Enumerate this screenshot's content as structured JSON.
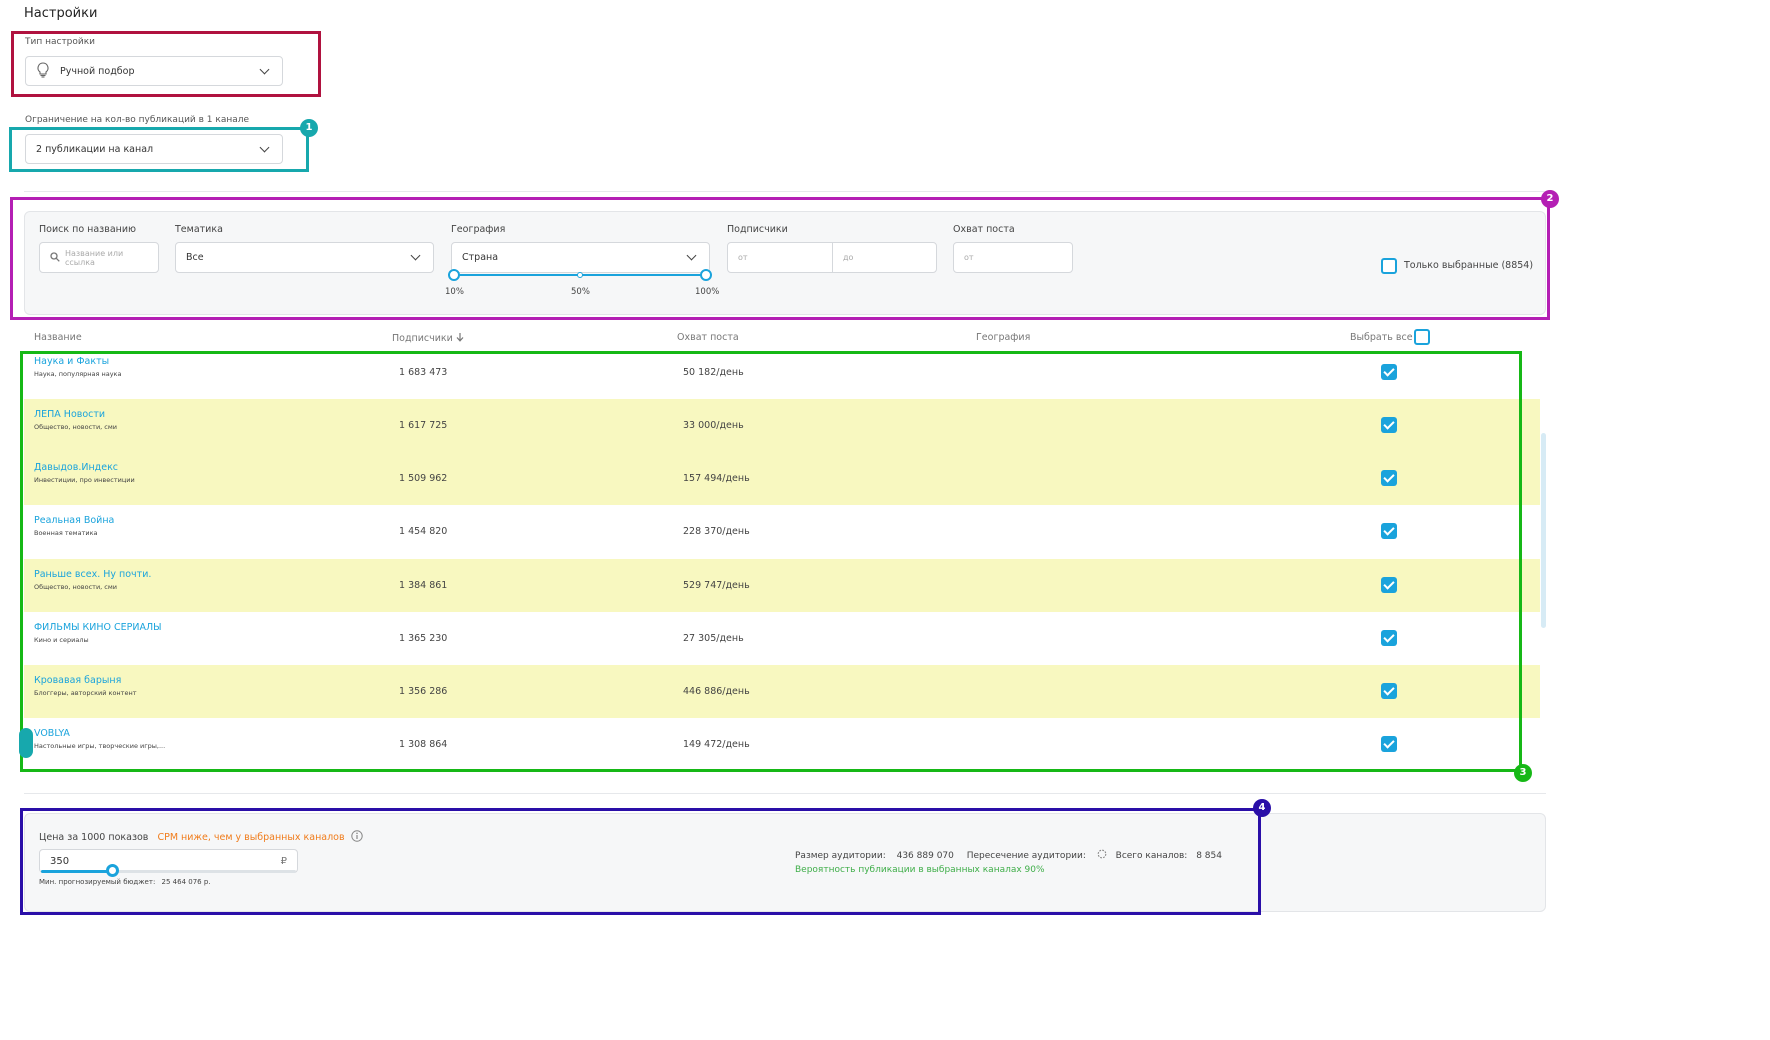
{
  "page": {
    "title": "Настройки"
  },
  "setup_type": {
    "label": "Тип настройки",
    "value": "Ручной подбор",
    "icon": "lightbulb-icon"
  },
  "limit": {
    "label": "Ограничение на кол-во публикаций в 1 канале",
    "value": "2 публикации на канал"
  },
  "annotations": [
    "1",
    "2",
    "3",
    "4"
  ],
  "filters": {
    "search": {
      "label": "Поиск по названию",
      "placeholder": "Название или ссылка"
    },
    "topic": {
      "label": "Тематика",
      "value": "Все"
    },
    "geo": {
      "label": "География",
      "value": "Страна",
      "slider": {
        "ticks": [
          "10%",
          "50%",
          "100%"
        ],
        "range": [
          10,
          100
        ]
      }
    },
    "subscribers": {
      "label": "Подписчики",
      "from": "от",
      "to": "до"
    },
    "reach": {
      "label": "Охват поста",
      "from": "от"
    },
    "only_selected": {
      "label": "Только выбранные (8854)",
      "checked": false
    }
  },
  "table": {
    "headers": {
      "name": "Название",
      "subscribers": "Подписчики",
      "reach": "Охват поста",
      "geo": "География",
      "select_all": "Выбрать все"
    },
    "sort_icon": "arrow-down-icon",
    "rows": [
      {
        "name": "Наука и Факты",
        "topic": "Наука, популярная наука",
        "subscribers": "1 683 473",
        "reach": "50 182/день",
        "checked": true,
        "highlight": false
      },
      {
        "name": "ЛЕПА Новости",
        "topic": "Общество, новости, сми",
        "subscribers": "1 617 725",
        "reach": "33 000/день",
        "checked": true,
        "highlight": true
      },
      {
        "name": "Давыдов.Индекс",
        "topic": "Инвестиции, про инвестиции",
        "subscribers": "1 509 962",
        "reach": "157 494/день",
        "checked": true,
        "highlight": true
      },
      {
        "name": "Реальная Война",
        "topic": "Военная тематика",
        "subscribers": "1 454 820",
        "reach": "228 370/день",
        "checked": true,
        "highlight": false
      },
      {
        "name": "Раньше всех. Ну почти.",
        "topic": "Общество, новости, сми",
        "subscribers": "1 384 861",
        "reach": "529 747/день",
        "checked": true,
        "highlight": true
      },
      {
        "name": "ФИЛЬМЫ КИНО СЕРИАЛЫ",
        "topic": "Кино и сериалы",
        "subscribers": "1 365 230",
        "reach": "27 305/день",
        "checked": true,
        "highlight": false
      },
      {
        "name": "Кровавая барыня",
        "topic": "Блоггеры, авторский контент",
        "subscribers": "1 356 286",
        "reach": "446 886/день",
        "checked": true,
        "highlight": true
      },
      {
        "name": "VOBLYA",
        "topic": "Настольные игры, творческие игры,...",
        "subscribers": "1 308 864",
        "reach": "149 472/день",
        "checked": true,
        "highlight": false
      }
    ]
  },
  "pricing": {
    "label": "Цена за 1000 показов",
    "warning": "CPM ниже, чем у выбранных каналов",
    "info_icon": "info-icon",
    "value": "350",
    "currency": "₽",
    "slider_level": 0.28,
    "min_budget_label": "Мин. прогнозируемый бюджет:",
    "min_budget_value": "25 464 076 р."
  },
  "summary": {
    "audience_label": "Размер аудитории:",
    "audience_value": "436 889 070",
    "overlap_label": "Пересечение аудитории:",
    "overlap_icon": "loading-spinner-icon",
    "channels_label": "Всего каналов:",
    "channels_value": "8 854",
    "probability": "Вероятность публикации в выбранных каналах 90%"
  },
  "colors": {
    "accent": "#1aa3dc",
    "highlight_row": "#f8f8c0",
    "frame_1": "#17a8ad",
    "frame_2": "#b41fb4",
    "frame_3": "#16b816",
    "frame_4": "#2a0fa8",
    "frame_setup": "#b0123f",
    "warning": "#f07c1b",
    "success": "#3fae49"
  }
}
